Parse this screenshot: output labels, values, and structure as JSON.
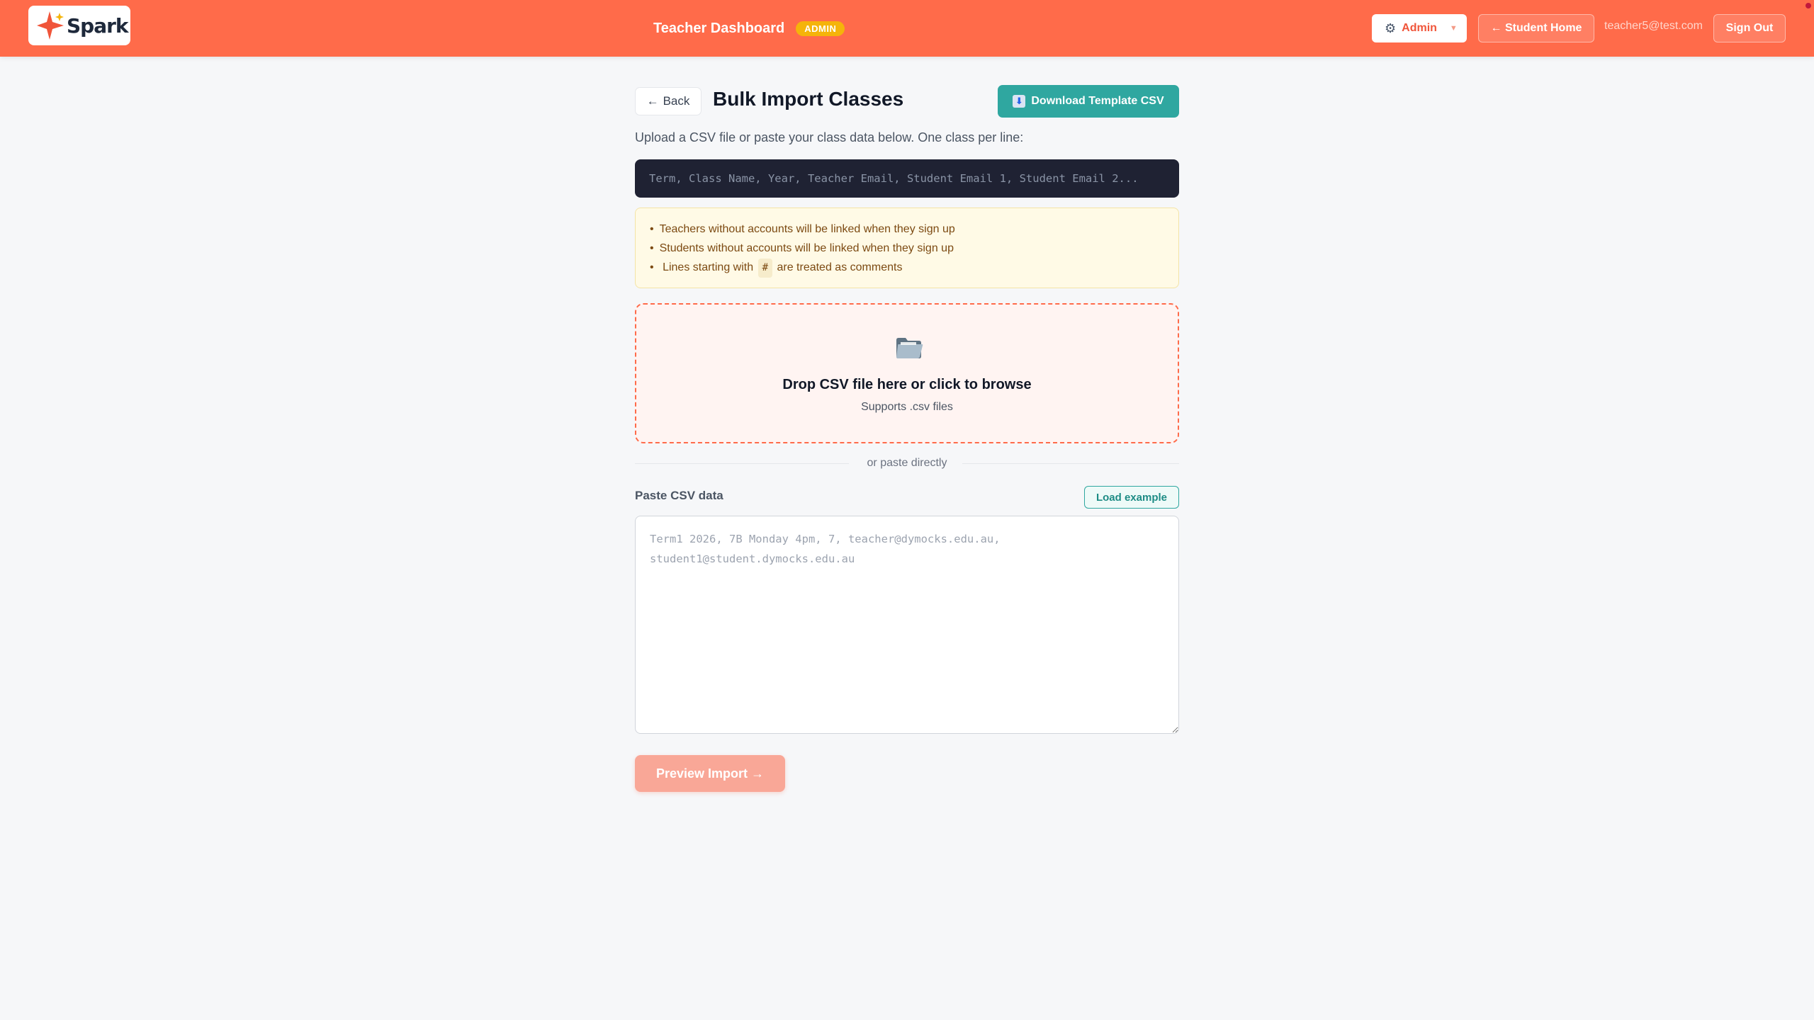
{
  "app": {
    "logo_text": "Spark",
    "brand_color": "#ff6b4a",
    "accent_color": "#2fa7a0"
  },
  "header": {
    "title": "Teacher Dashboard",
    "badge": "ADMIN",
    "role_select": {
      "icon": "gear-icon",
      "value": "Admin"
    },
    "student_home_label": "← Student Home",
    "user_email": "teacher5@test.com",
    "sign_out_label": "Sign Out"
  },
  "page": {
    "back_label": "Back",
    "title": "Bulk Import Classes",
    "download_label": "Download Template CSV",
    "intro": "Upload a CSV file or paste your class data below. One class per line:",
    "format_line": "Term, Class Name, Year, Teacher Email, Student Email 1, Student Email 2...",
    "notes": {
      "item1": "Teachers without accounts will be linked when they sign up",
      "item2": "Students without accounts will be linked when they sign up",
      "item3_before": "Lines starting with",
      "item3_code": "#",
      "item3_after": "are treated as comments"
    },
    "dropzone": {
      "icon": "folder-icon",
      "title": "Drop CSV file here or click to browse",
      "subtitle": "Supports .csv files"
    },
    "divider_text": "or paste directly",
    "paste": {
      "label": "Paste CSV data",
      "load_example_label": "Load example",
      "value": "",
      "placeholder": "Term1 2026, 7B Monday 4pm, 7, teacher@dymocks.edu.au,\nstudent1@student.dymocks.edu.au"
    },
    "preview_label": "Preview Import →"
  }
}
